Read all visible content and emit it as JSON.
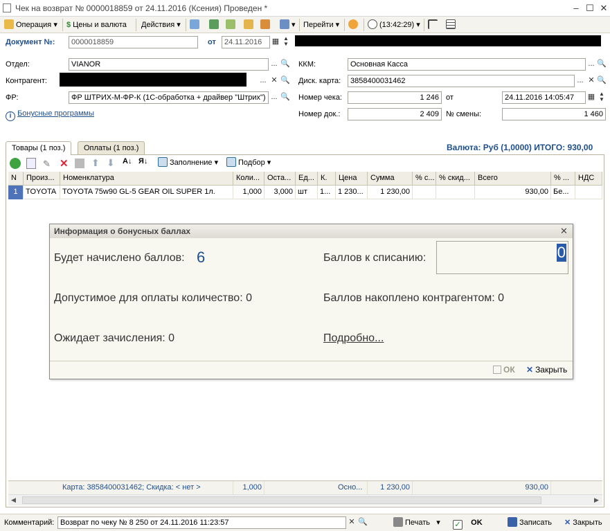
{
  "window": {
    "title": "Чек на возврат № 0000018859 от 24.11.2016 (Ксения) Проведен *"
  },
  "toolbar": {
    "operation": "Операция",
    "prices": "Цены и валюта",
    "actions": "Действия",
    "goto": "Перейти",
    "time": "(13:42:29)"
  },
  "doc": {
    "label": "Документ №:",
    "number": "0000018859",
    "date_label": "от",
    "date": "24.11.2016"
  },
  "form": {
    "dept_label": "Отдел:",
    "dept": "VIANOR",
    "contractor_label": "Контрагент:",
    "fr_label": "ФР:",
    "fr": "ФР ШТРИХ-М-ФР-К (1С-обработка + драйвер \"Штрих\") М",
    "bonus_link": "Бонусные программы",
    "kkm_label": "ККМ:",
    "kkm": "Основная Касса",
    "card_label": "Диск. карта:",
    "card": "3858400031462",
    "check_no_label": "Номер чека:",
    "check_no": "1 246",
    "check_date_label": "от",
    "check_date": "24.11.2016 14:05:47",
    "doc_no_label": "Номер док.:",
    "doc_no": "2 409",
    "shift_label": "№ смены:",
    "shift": "1 460"
  },
  "tabs": [
    {
      "label": "Товары (1 поз.)"
    },
    {
      "label": "Оплаты (1 поз.)"
    }
  ],
  "currency": "Валюта: Руб (1,0000) ИТОГО: 930,00",
  "table_toolbar": {
    "fill": "Заполнение",
    "select": "Подбор"
  },
  "table": {
    "headers": [
      "N",
      "Произ...",
      "Номенклатура",
      "Коли...",
      "Оста...",
      "Ед...",
      "К.",
      "Цена",
      "Сумма",
      "% с...",
      "% скид...",
      "Всего",
      "% ...",
      "НДС"
    ],
    "rows": [
      [
        "1",
        "TOYOTA",
        "TOYOTA 75w90 GL-5 GEAR OIL SUPER 1л.",
        "1,000",
        "3,000",
        "шт",
        "1...",
        "1 230...",
        "1 230,00",
        "",
        "",
        "930,00",
        "Бе...",
        ""
      ]
    ],
    "footer": {
      "card": "Карта: 3858400031462; Скидка: < нет >",
      "qty": "1,000",
      "price": "Осно...",
      "sum": "1 230,00",
      "total": "930,00"
    }
  },
  "dialog": {
    "title": "Информация о бонусных баллах",
    "accrue_label": "Будет начислено баллов:",
    "accrue_value": "6",
    "writeoff_label": "Баллов к списанию:",
    "writeoff_value": "0",
    "allowed": "Допустимое для оплаты количество: 0",
    "accumulated": "Баллов накоплено контрагентом: 0",
    "pending": "Ожидает зачисления: 0",
    "details": "Подробно...",
    "ok": "ОК",
    "close": "Закрыть"
  },
  "bottom": {
    "comment_label": "Комментарий:",
    "comment": "Возврат по чеку № 8 250 от 24.11.2016 11:23:57",
    "print": "Печать",
    "ok": "OK",
    "save": "Записать",
    "close": "Закрыть"
  }
}
